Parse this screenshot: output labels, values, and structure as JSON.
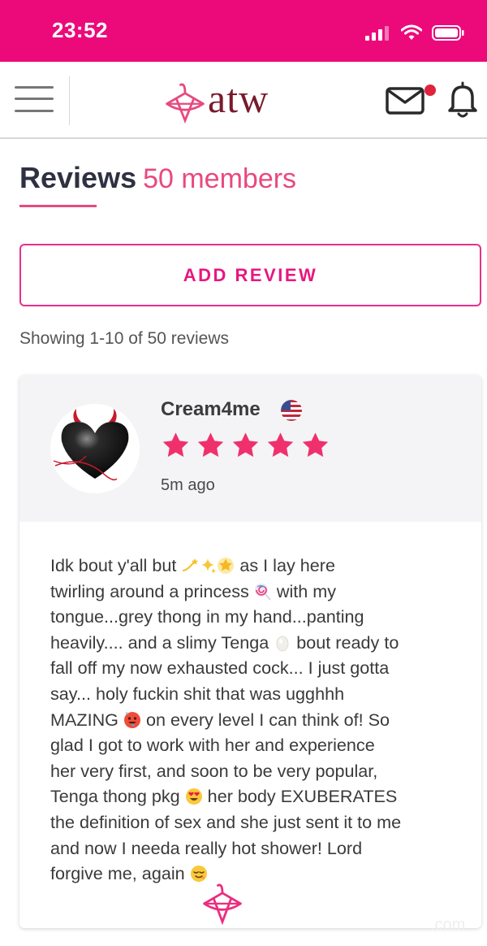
{
  "status_bar": {
    "time": "23:52"
  },
  "header": {
    "logo_text": "atw",
    "has_new_message": true
  },
  "page": {
    "title": "Reviews",
    "count_label": "50 members",
    "add_review_label": "ADD REVIEW",
    "showing_text": "Showing 1-10 of 50 reviews"
  },
  "review": {
    "reviewer": "Cream4me",
    "rating": 5,
    "time_ago": "5m ago",
    "lines": [
      {
        "text": "Idk bout y'all but ",
        "emoji": [
          "dizzy-emoji",
          "sparkles-emoji",
          "glowing-star-emoji"
        ],
        "after": " as I lay here"
      },
      {
        "text": "twirling around a princess ",
        "emoji": [
          "lollipop-emoji"
        ],
        "after": " with my"
      },
      {
        "text": "tongue...grey thong in my hand...panting",
        "emoji": [],
        "after": ""
      },
      {
        "text": "heavily.... and a slimy Tenga ",
        "emoji": [
          "egg-emoji"
        ],
        "after": " bout ready to"
      },
      {
        "text": "fall off my now exhausted cock... I just gotta",
        "emoji": [],
        "after": ""
      },
      {
        "text": "say... holy fuckin shit that was ugghhh",
        "emoji": [],
        "after": ""
      },
      {
        "text": "MAZING ",
        "emoji": [
          "hot-face-emoji"
        ],
        "after": " on every level I can think of! So"
      },
      {
        "text": "glad I got to work with her and experience",
        "emoji": [],
        "after": ""
      },
      {
        "text": "her very first, and soon to be very popular,",
        "emoji": [],
        "after": ""
      },
      {
        "text": "Tenga thong pkg ",
        "emoji": [
          "heart-eyes-emoji"
        ],
        "after": " her body EXUBERATES"
      },
      {
        "text": "the definition of sex and she just sent it to me",
        "emoji": [],
        "after": ""
      },
      {
        "text": "and now I needa really hot shower! Lord",
        "emoji": [],
        "after": ""
      },
      {
        "text": "forgive me, again ",
        "emoji": [
          "relieved-face-emoji"
        ],
        "after": ""
      }
    ]
  },
  "watermark": ".com",
  "colors": {
    "brand": "#ec0a7b",
    "accent": "#e7177f",
    "star": "#f0306c",
    "title": "#2f3142"
  }
}
